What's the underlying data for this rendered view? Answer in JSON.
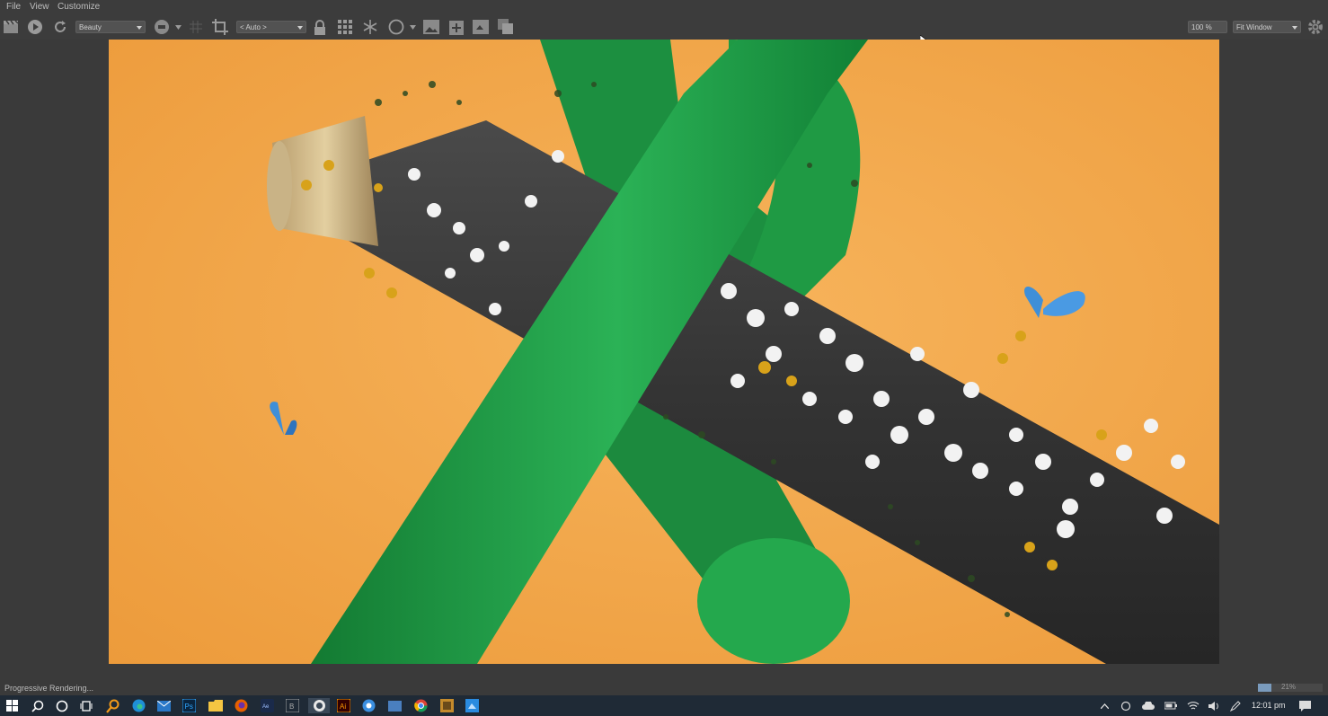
{
  "menu": {
    "file": "File",
    "view": "View",
    "customize": "Customize"
  },
  "toolbar": {
    "channel_select": "Beauty",
    "region_select": "< Auto >",
    "zoom_value": "100 %",
    "fit_select": "Fit Window"
  },
  "status": {
    "message": "Progressive Rendering...",
    "progress_percent": 21,
    "progress_label": "21%"
  },
  "taskbar": {
    "clock": "12:01 pm",
    "apps": [
      "start",
      "search",
      "cortana",
      "task-view",
      "magnifier",
      "edge",
      "mail",
      "photoshop",
      "file-explorer",
      "firefox",
      "adobe",
      "premiere",
      "render-view",
      "illustrator",
      "chrome-canary",
      "mail-alt",
      "chrome",
      "folder-app",
      "blue-app"
    ]
  },
  "colors": {
    "ui_bg": "#3c3c3c",
    "backdrop": "#f2a446",
    "green_tube": "#1f9a44",
    "dark_log": "#3c3c3c",
    "butterfly": "#3f8fd8",
    "taskbar": "#1f2a36"
  }
}
